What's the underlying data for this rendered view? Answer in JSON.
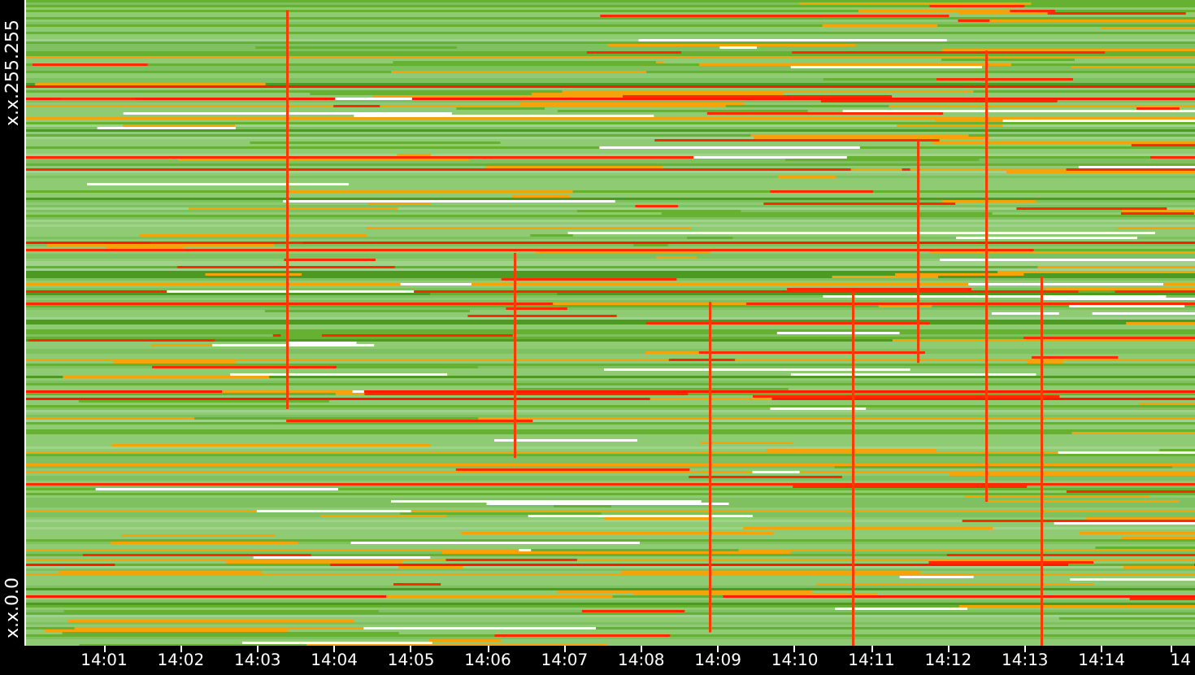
{
  "y_axis": {
    "labels": [
      "x.x.255.255",
      "x.x.0.0"
    ]
  },
  "x_axis": {
    "ticks": [
      "14:01",
      "14:02",
      "14:03",
      "14:04",
      "14:05",
      "14:06",
      "14:07",
      "14:08",
      "14:09",
      "14:10",
      "14:11",
      "14:12",
      "14:13",
      "14:14",
      "14"
    ]
  }
}
